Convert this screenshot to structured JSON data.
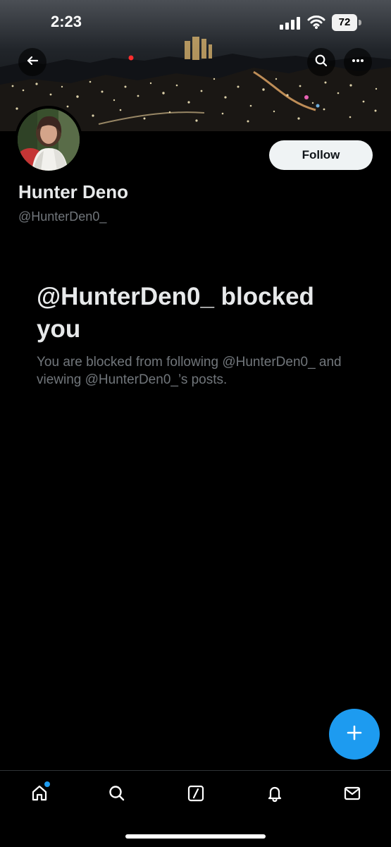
{
  "status_bar": {
    "time": "2:23",
    "battery_level": "72"
  },
  "header": {
    "back_icon": "arrow-left-icon",
    "search_icon": "search-icon",
    "more_icon": "more-horizontal-icon"
  },
  "profile": {
    "display_name": "Hunter Deno",
    "handle": "@HunterDen0_",
    "follow_label": "Follow"
  },
  "blocked": {
    "title": "@HunterDen0_ blocked you",
    "description": "You are blocked from following @HunterDen0_ and viewing @HunterDen0_’s posts."
  },
  "colors": {
    "accent": "#1d9bf0",
    "follow_button_bg": "#eff3f4",
    "background": "#000000",
    "muted_text": "#71767b"
  },
  "bottom_nav": {
    "items": [
      {
        "name": "home",
        "icon": "home-icon"
      },
      {
        "name": "search",
        "icon": "search-icon"
      },
      {
        "name": "grok",
        "icon": "slash-box-icon"
      },
      {
        "name": "notifications",
        "icon": "bell-icon"
      },
      {
        "name": "messages",
        "icon": "mail-icon"
      }
    ]
  },
  "fab": {
    "icon": "plus-icon"
  }
}
